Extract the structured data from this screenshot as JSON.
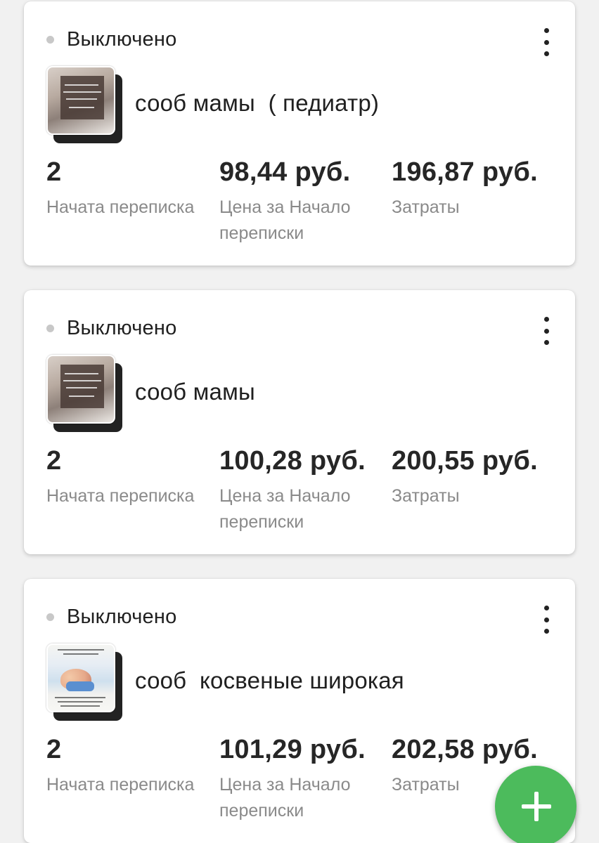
{
  "cards": [
    {
      "status": "Выключено",
      "title": "сооб мамы  ( педиатр)",
      "metrics": [
        {
          "value": "2",
          "label": "Начата переписка"
        },
        {
          "value": "98,44 руб.",
          "label": "Цена за Начало переписки"
        },
        {
          "value": "196,87 руб.",
          "label": "Затраты"
        }
      ]
    },
    {
      "status": "Выключено",
      "title": "сооб мамы",
      "metrics": [
        {
          "value": "2",
          "label": "Начата переписка"
        },
        {
          "value": "100,28 руб.",
          "label": "Цена за Начало переписки"
        },
        {
          "value": "200,55 руб.",
          "label": "Затраты"
        }
      ]
    },
    {
      "status": "Выключено",
      "title": "сооб  косвеные широкая",
      "metrics": [
        {
          "value": "2",
          "label": "Начата переписка"
        },
        {
          "value": "101,29 руб.",
          "label": "Цена за Начало переписки"
        },
        {
          "value": "202,58 руб.",
          "label": "Затраты"
        }
      ]
    }
  ],
  "icons": {
    "status": "status-dot-icon",
    "menu": "more-vertical-icon",
    "fab": "plus-icon"
  },
  "colors": {
    "fab": "#4cbb5c",
    "status_dot": "#c8c8c8",
    "label": "#8a8a8a"
  }
}
